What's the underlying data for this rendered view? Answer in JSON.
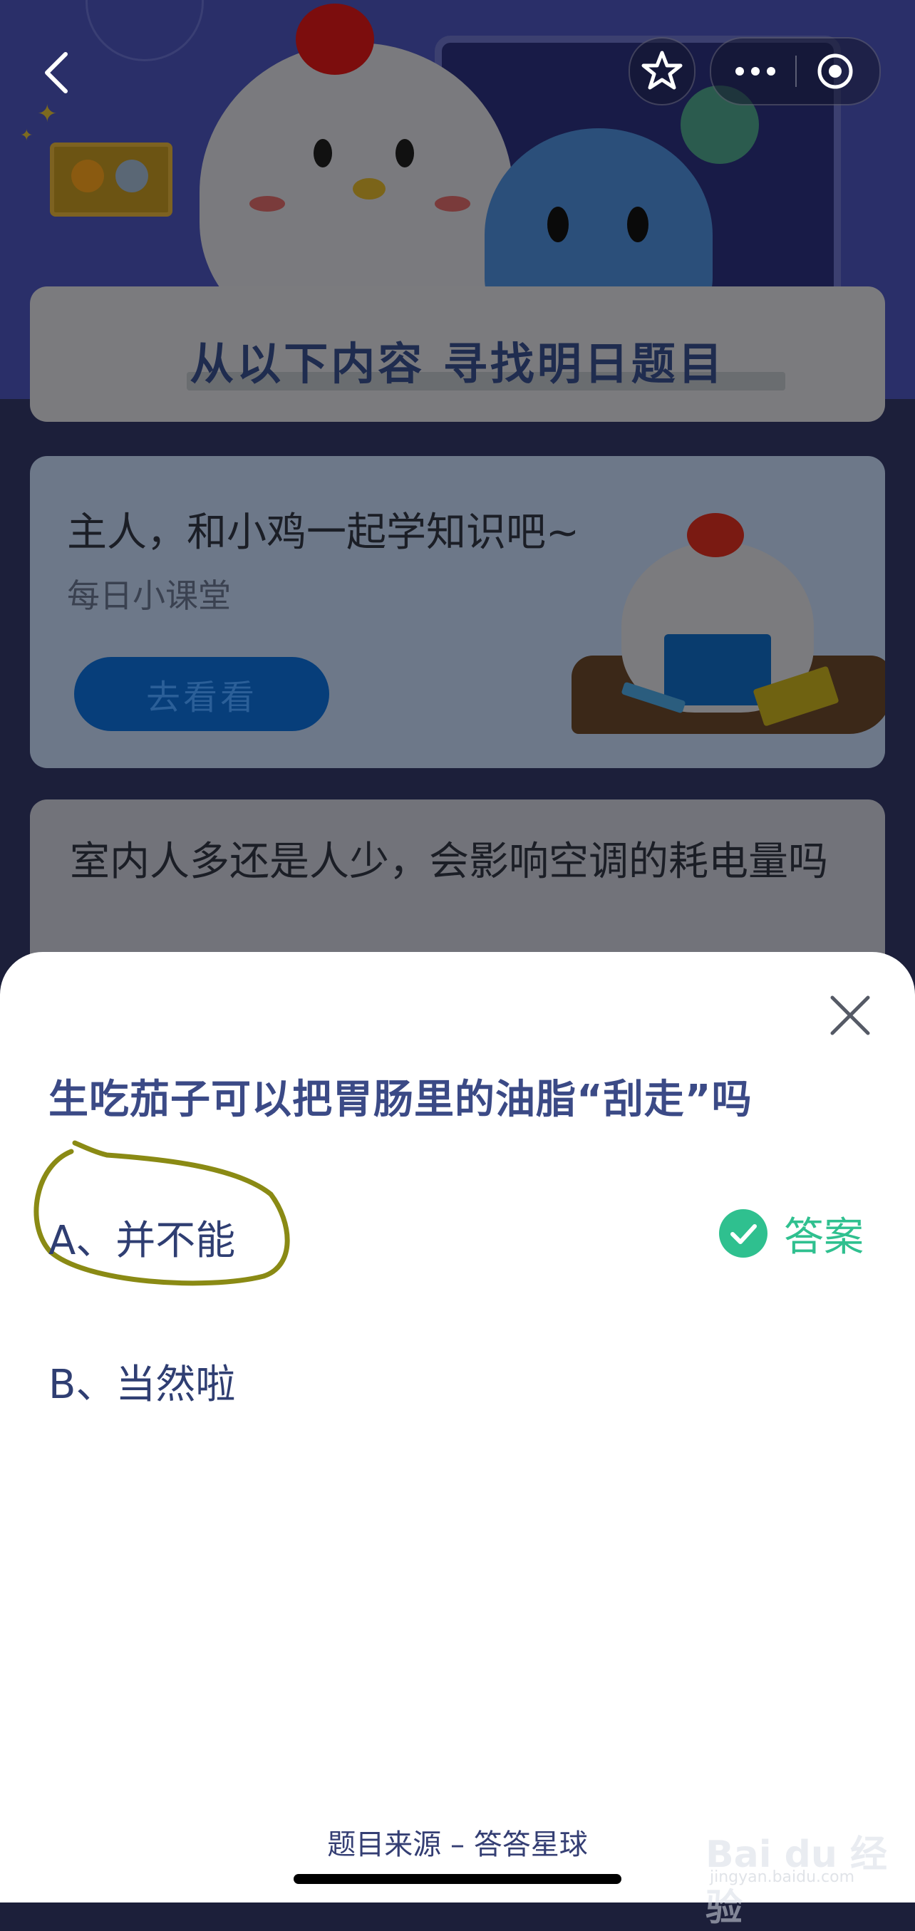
{
  "background_page": {
    "find_title": "从以下内容 寻找明日题目",
    "lesson_card": {
      "title": "主人，和小鸡一起学知识吧~",
      "subtitle": "每日小课堂",
      "button": "去看看"
    },
    "question_card_text": "室内人多还是人少，会影响空调的耗电量吗"
  },
  "top_nav": {
    "back_icon": "chevron-left-icon",
    "favorite_icon": "star-icon",
    "more_icon": "more-dots-icon",
    "target_icon": "target-circle-icon"
  },
  "quiz_sheet": {
    "question": "生吃茄子可以把胃肠里的油脂“刮走”吗",
    "options": [
      {
        "label": "A、并不能",
        "is_answer": true
      },
      {
        "label": "B、当然啦",
        "is_answer": false
      }
    ],
    "answer_label": "答案",
    "source": "题目来源 – 答答星球",
    "colors": {
      "question": "#3b4a86",
      "option": "#2f3e72",
      "answer": "#2fc08f",
      "annotation_circle": "#8a8a14"
    }
  },
  "watermark": {
    "text": "Bai du 经验",
    "sub": "jingyan.baidu.com"
  }
}
